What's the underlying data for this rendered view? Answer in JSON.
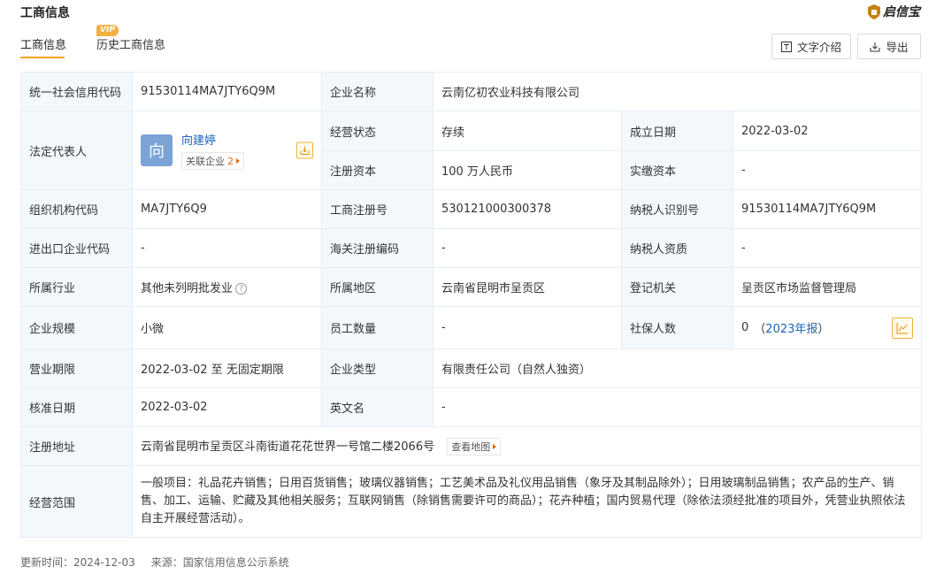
{
  "header": {
    "title": "工商信息",
    "logo_text": "启信宝",
    "brand_color": "#f5a623"
  },
  "tabs": [
    {
      "label": "工商信息",
      "active": true
    },
    {
      "label": "历史工商信息",
      "active": false,
      "badge": "VIP"
    }
  ],
  "toolbar": {
    "text_intro_label": "文字介绍",
    "export_label": "导出"
  },
  "fields": {
    "credit_code": {
      "label": "统一社会信用代码",
      "value": "91530114MA7JTY6Q9M"
    },
    "company_name": {
      "label": "企业名称",
      "value": "云南亿初农业科技有限公司"
    },
    "legal_rep": {
      "label": "法定代表人",
      "avatar_char": "向",
      "name": "向建婷",
      "related_label": "关联企业",
      "related_count": "2"
    },
    "status": {
      "label": "经营状态",
      "value": "存续"
    },
    "founded": {
      "label": "成立日期",
      "value": "2022-03-02"
    },
    "reg_capital": {
      "label": "注册资本",
      "value": "100 万人民币"
    },
    "paid_capital": {
      "label": "实缴资本",
      "value": "-"
    },
    "org_code": {
      "label": "组织机构代码",
      "value": "MA7JTY6Q9"
    },
    "reg_no": {
      "label": "工商注册号",
      "value": "530121000300378"
    },
    "taxpayer_id": {
      "label": "纳税人识别号",
      "value": "91530114MA7JTY6Q9M"
    },
    "import_export": {
      "label": "进出口企业代码",
      "value": "-"
    },
    "customs": {
      "label": "海关注册编码",
      "value": "-"
    },
    "taxpayer_qual": {
      "label": "纳税人资质",
      "value": "-"
    },
    "industry": {
      "label": "所属行业",
      "value": "其他未列明批发业"
    },
    "region": {
      "label": "所属地区",
      "value": "云南省昆明市呈贡区"
    },
    "authority": {
      "label": "登记机关",
      "value": "呈贡区市场监督管理局"
    },
    "scale": {
      "label": "企业规模",
      "value": "小微"
    },
    "employees": {
      "label": "员工数量",
      "value": "-"
    },
    "insured": {
      "label": "社保人数",
      "value": "0",
      "open_paren": "（",
      "report_link": "2023年报",
      "close_paren": "）"
    },
    "term": {
      "label": "营业期限",
      "value": "2022-03-02 至 无固定期限"
    },
    "company_type": {
      "label": "企业类型",
      "value": "有限责任公司（自然人独资）"
    },
    "approved": {
      "label": "核准日期",
      "value": "2022-03-02"
    },
    "english_name": {
      "label": "英文名",
      "value": "-"
    },
    "address": {
      "label": "注册地址",
      "value": "云南省昆明市呈贡区斗南街道花花世界一号馆二楼2066号",
      "map_label": "查看地图"
    },
    "scope": {
      "label": "经营范围",
      "value": "一般项目：礼品花卉销售；日用百货销售；玻璃仪器销售；工艺美术品及礼仪用品销售（象牙及其制品除外）；日用玻璃制品销售；农产品的生产、销售、加工、运输、贮藏及其他相关服务；互联网销售（除销售需要许可的商品）；花卉种植；国内贸易代理（除依法须经批准的项目外，凭营业执照依法自主开展经营活动）。"
    }
  },
  "footer": {
    "update_label": "更新时间：",
    "update_date": "2024-12-03",
    "source_label": "来源：",
    "source_value": "国家信用信息公示系统"
  }
}
